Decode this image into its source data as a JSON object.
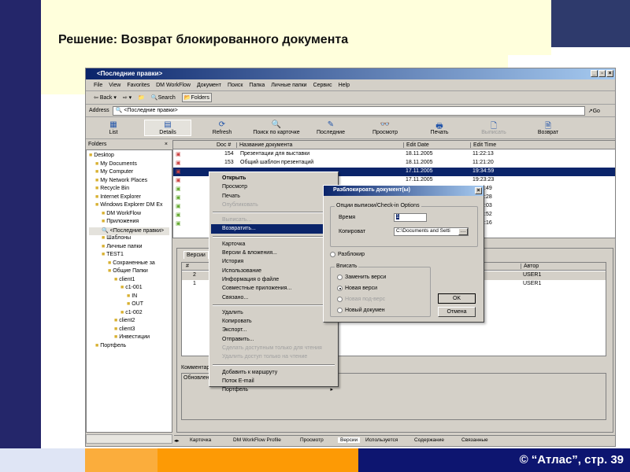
{
  "slide": {
    "title": "Решение: Возврат блокированного документа",
    "footer": "© “Атлас”, стр. 39"
  },
  "window": {
    "title": "<Последние правки>",
    "menu": [
      "File",
      "View",
      "Favorites",
      "DM WorkFlow",
      "Документ",
      "Поиск",
      "Папка",
      "Личные папки",
      "Сервис",
      "Help"
    ],
    "toolbar": {
      "back": "Back",
      "search": "Search",
      "folders": "Folders"
    },
    "address_label": "Address",
    "address_value": "<Последние правки>",
    "go": "Go",
    "big_toolbar": [
      {
        "label": "List",
        "icon": "list-icon"
      },
      {
        "label": "Details",
        "icon": "details-icon"
      },
      {
        "label": "Refresh",
        "icon": "refresh-icon"
      },
      {
        "label": "Поиск по карточке",
        "icon": "search-icon"
      },
      {
        "label": "Последние",
        "icon": "recent-icon"
      },
      {
        "label": "Просмотр",
        "icon": "view-icon"
      },
      {
        "label": "Печать",
        "icon": "print-icon"
      },
      {
        "label": "Выписать",
        "icon": "checkout-icon"
      },
      {
        "label": "Возврат",
        "icon": "checkin-icon"
      }
    ],
    "folders_title": "Folders",
    "tree": [
      "Desktop",
      "My Documents",
      "My Computer",
      "My Network Places",
      "Recycle Bin",
      "Internet Explorer",
      "Windows Explorer DM Ex",
      "DM WorkFlow",
      "Приложения",
      "<Последние правки>",
      "Шаблоны",
      "Личные папки",
      "TEST1",
      "Сохраненные за",
      "Общие Папки",
      "client1",
      "c1-001",
      "IN",
      "OUT",
      "c1-002",
      "client2",
      "client3",
      "Инвестиции",
      "Портфель"
    ],
    "columns": [
      "Doc #",
      "Название документа",
      "Edit Date",
      "Edit Time"
    ],
    "rows": [
      {
        "doc": "154",
        "name": "Презентации для выставки",
        "date": "18.11.2005",
        "time": "11:22:13"
      },
      {
        "doc": "153",
        "name": "Общий шаблон презентаций",
        "date": "18.11.2005",
        "time": "11:21:20"
      },
      {
        "doc": "",
        "name": "",
        "date": "17.11.2005",
        "time": "19:34:59"
      },
      {
        "doc": "",
        "name": "",
        "date": "17.11.2005",
        "time": "19:23:23"
      }
    ],
    "partial_times": [
      ":49",
      ":28",
      ":03",
      ":52",
      ":16"
    ],
    "lower_tabs": [
      "Версии"
    ],
    "versions_columns": [
      "#",
      "Автор"
    ],
    "versions": [
      {
        "num": "2",
        "author": "USER1"
      },
      {
        "num": "1",
        "author": "USER1"
      }
    ],
    "comment_label": "Комментарий",
    "comment_value": "Обновлен",
    "bottom_tabs": [
      "Карточка",
      "DM WorkFlow Profile",
      "Просмотр",
      "Версии",
      "Используется",
      "Содержание",
      "Связанные"
    ]
  },
  "context_menu": [
    [
      {
        "l": "Открыть",
        "s": "bold"
      },
      {
        "l": "Просмотр"
      },
      {
        "l": "Печать"
      },
      {
        "l": "Опубликовать",
        "s": "dis"
      }
    ],
    [
      {
        "l": "Выписать...",
        "s": "dis"
      },
      {
        "l": "Возвратить...",
        "s": "hl"
      }
    ],
    [
      {
        "l": "Карточка"
      },
      {
        "l": "Версии & вложения..."
      },
      {
        "l": "История"
      },
      {
        "l": "Использование"
      },
      {
        "l": "Информация о файле"
      },
      {
        "l": "Совместные приложения..."
      },
      {
        "l": "Связано..."
      }
    ],
    [
      {
        "l": "Удалить"
      },
      {
        "l": "Копировать"
      },
      {
        "l": "Экспорт..."
      },
      {
        "l": "Отправить..."
      },
      {
        "l": "Сделать доступным только для чтения",
        "s": "dis"
      },
      {
        "l": "Удалить доступ только на чтение",
        "s": "dis"
      }
    ],
    [
      {
        "l": "Добавить к маршруту"
      },
      {
        "l": "Поток E-mail"
      },
      {
        "l": "Портфель",
        "sub": true
      }
    ]
  ],
  "dialog": {
    "title": "Разблокироать документ(ы)",
    "group": "Опции выписки/Check-in Options",
    "time_label": "Время",
    "time_value": "1",
    "copy_label": "Копироват",
    "copy_value": "C:\\Documents and Setti",
    "unlock": "Разблокир",
    "write_group": "Вписать",
    "options": [
      {
        "l": "Заменить верси",
        "on": false,
        "dis": false
      },
      {
        "l": "Новая верси",
        "on": true,
        "dis": false
      },
      {
        "l": "Новая под-верс",
        "on": false,
        "dis": true
      },
      {
        "l": "Новый докумен",
        "on": false,
        "dis": false
      }
    ],
    "ok": "OK",
    "cancel": "Отмена"
  }
}
